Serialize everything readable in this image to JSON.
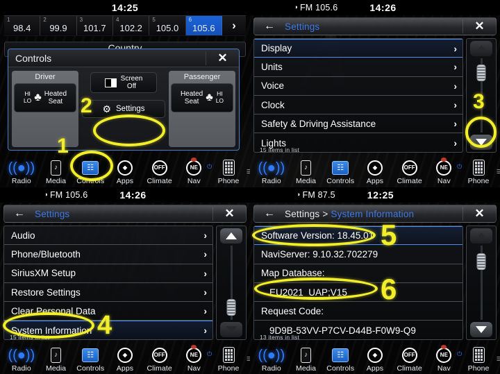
{
  "meta": {
    "accent_blue": "#3e78e8",
    "highlight_yellow": "#f2ef2a",
    "selected_preset_blue": "#1b63d8"
  },
  "nav": {
    "items": [
      {
        "label": "Radio",
        "icon": "radio-tower-icon"
      },
      {
        "label": "Media",
        "icon": "media-device-icon"
      },
      {
        "label": "Controls",
        "icon": "controls-cards-icon"
      },
      {
        "label": "Apps",
        "icon": "apps-icon"
      },
      {
        "label": "Climate",
        "icon": "climate-off-icon"
      },
      {
        "label": "Nav",
        "icon": "nav-compass-icon"
      },
      {
        "label": "Phone",
        "icon": "phone-keypad-icon"
      }
    ],
    "climate_state": "OFF",
    "nav_state": "NE"
  },
  "panel_tl": {
    "status": {
      "source": "",
      "clock": "14:25"
    },
    "presets": [
      {
        "num": "1",
        "freq": "98.4",
        "active": false
      },
      {
        "num": "2",
        "freq": "99.9",
        "active": false
      },
      {
        "num": "3",
        "freq": "101.7",
        "active": false
      },
      {
        "num": "4",
        "freq": "102.2",
        "active": false
      },
      {
        "num": "5",
        "freq": "105.0",
        "active": false
      },
      {
        "num": "6",
        "freq": "105.6",
        "active": true
      }
    ],
    "next_label": "›",
    "genre": "Country",
    "dialog": {
      "title": "Controls",
      "close_label": "✕",
      "driver": {
        "zone_label": "Driver",
        "hi": "HI",
        "lo": "LO",
        "seat_label_line1": "Heated",
        "seat_label_line2": "Seat"
      },
      "passenger": {
        "zone_label": "Passenger",
        "hi": "HI",
        "lo": "LO",
        "seat_label_line1": "Heated",
        "seat_label_line2": "Seat"
      },
      "screen_off_line1": "Screen",
      "screen_off_line2": "Off",
      "settings_label": "Settings"
    }
  },
  "panel_tr": {
    "status": {
      "source": "FM 105.6",
      "clock": "14:26"
    },
    "header": {
      "back_label": "←",
      "title": "Settings",
      "close_label": "✕"
    },
    "rows": [
      {
        "label": "Display",
        "selected": true
      },
      {
        "label": "Units",
        "selected": false
      },
      {
        "label": "Voice",
        "selected": false
      },
      {
        "label": "Clock",
        "selected": false
      },
      {
        "label": "Safety & Driving Assistance",
        "selected": false
      },
      {
        "label": "Lights",
        "selected": false
      }
    ],
    "item_count": "15 items in list",
    "scroll": {
      "up_active": false,
      "down_active": true,
      "thumb_pos_pct": 8
    }
  },
  "panel_bl": {
    "status": {
      "source": "FM 105.6",
      "clock": "14:26"
    },
    "header": {
      "back_label": "←",
      "title": "Settings",
      "close_label": "✕"
    },
    "rows": [
      {
        "label": "Audio",
        "selected": false
      },
      {
        "label": "Phone/Bluetooth",
        "selected": false
      },
      {
        "label": "SiriusXM Setup",
        "selected": false
      },
      {
        "label": "Restore Settings",
        "selected": false
      },
      {
        "label": "Clear Personal Data",
        "selected": false
      },
      {
        "label": "System Information",
        "selected": true
      }
    ],
    "item_count": "15 items in list",
    "scroll": {
      "up_active": true,
      "down_active": false,
      "thumb_pos_pct": 72
    }
  },
  "panel_br": {
    "status": {
      "source": "FM 87.5",
      "clock": "12:25"
    },
    "header": {
      "back_label": "←",
      "crumb_root": "Settings > ",
      "crumb_leaf": "System Information",
      "close_label": "✕"
    },
    "rows": [
      {
        "label": "Software Version: 18.45.01",
        "selected": true,
        "indent": false
      },
      {
        "label": "NaviServer: 9.10.32.702279",
        "selected": false,
        "indent": false
      },
      {
        "label": "Map Database:",
        "selected": false,
        "indent": false
      },
      {
        "label": "EU2021_UAP;V15",
        "selected": false,
        "indent": true
      },
      {
        "label": "Request Code:",
        "selected": false,
        "indent": false
      },
      {
        "label": "9D9B-53VV-P7CV-D44B-F0W9-Q9",
        "selected": false,
        "indent": true
      }
    ],
    "item_count": "13 items in list",
    "scroll": {
      "up_active": false,
      "down_active": true,
      "thumb_pos_pct": 10
    }
  },
  "annotations": [
    {
      "id": "1",
      "number": "1",
      "target": "controls-nav-button"
    },
    {
      "id": "2",
      "number": "2",
      "target": "settings-button"
    },
    {
      "id": "3",
      "number": "3",
      "target": "scroll-down-button"
    },
    {
      "id": "4",
      "number": "4",
      "target": "system-information-row"
    },
    {
      "id": "5",
      "number": "5",
      "target": "software-version-row"
    },
    {
      "id": "6",
      "number": "6",
      "target": "map-database-value-row"
    }
  ]
}
